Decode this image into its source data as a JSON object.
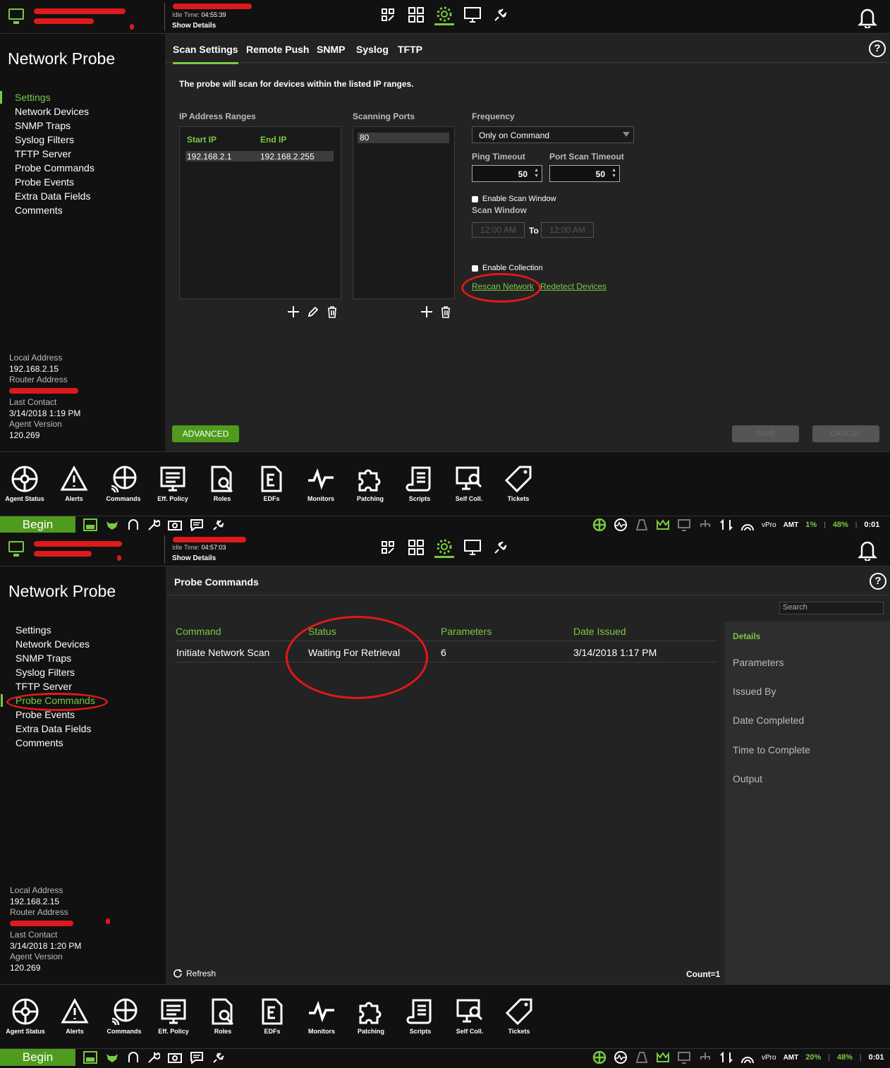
{
  "screens": [
    {
      "idle_label": "Idle Time:",
      "idle_time": "04:55:39",
      "show_details": "Show Details",
      "sidebar": {
        "title": "Network Probe",
        "items": [
          "Settings",
          "Network Devices",
          "SNMP Traps",
          "Syslog Filters",
          "TFTP Server",
          "Probe Commands",
          "Probe Events",
          "Extra Data Fields",
          "Comments"
        ],
        "active": "Settings",
        "local_address_label": "Local Address",
        "local_address": "192.168.2.15",
        "router_address_label": "Router Address",
        "last_contact_label": "Last Contact",
        "last_contact": "3/14/2018 1:19 PM",
        "agent_version_label": "Agent Version",
        "agent_version": "120.269"
      },
      "tabs": [
        "Scan Settings",
        "Remote Push",
        "SNMP",
        "Syslog",
        "TFTP"
      ],
      "active_tab": "Scan Settings",
      "intro": "The probe will scan for devices within the listed IP ranges.",
      "ip_ranges_label": "IP Address Ranges",
      "start_ip_label": "Start IP",
      "end_ip_label": "End IP",
      "ip_range": {
        "start": "192.168.2.1",
        "end": "192.168.2.255"
      },
      "scanning_ports_label": "Scanning Ports",
      "port": "80",
      "frequency_label": "Frequency",
      "frequency": "Only on Command",
      "ping_timeout_label": "Ping Timeout",
      "ping_timeout": "50",
      "port_scan_timeout_label": "Port Scan Timeout",
      "port_scan_timeout": "50",
      "enable_scan_window": "Enable Scan Window",
      "scan_window_label": "Scan Window",
      "scan_window_from": "12:00 AM",
      "scan_window_to_label": "To",
      "scan_window_to": "12:00 AM",
      "enable_collection": "Enable Collection",
      "rescan_network": "Rescan Network",
      "redetect_devices": "Redetect Devices",
      "advanced": "ADVANCED",
      "save": "SAVE",
      "cancel": "CANCEL",
      "cpu_pct": "1%",
      "mem_pct": "48%",
      "clock": "0:01"
    },
    {
      "idle_label": "Idle Time:",
      "idle_time": "04:57:03",
      "show_details": "Show Details",
      "sidebar": {
        "title": "Network Probe",
        "items": [
          "Settings",
          "Network Devices",
          "SNMP Traps",
          "Syslog Filters",
          "TFTP Server",
          "Probe Commands",
          "Probe Events",
          "Extra Data Fields",
          "Comments"
        ],
        "active": "Probe Commands",
        "local_address_label": "Local Address",
        "local_address": "192.168.2.15",
        "router_address_label": "Router Address",
        "last_contact_label": "Last Contact",
        "last_contact": "3/14/2018 1:20 PM",
        "agent_version_label": "Agent Version",
        "agent_version": "120.269"
      },
      "page_title": "Probe Commands",
      "search_placeholder": "Search",
      "columns": [
        "Command",
        "Status",
        "Parameters",
        "Date Issued"
      ],
      "rows": [
        {
          "command": "Initiate Network Scan",
          "status": "Waiting For Retrieval",
          "parameters": "6",
          "date_issued": "3/14/2018 1:17 PM"
        }
      ],
      "details_title": "Details",
      "details_items": [
        "Parameters",
        "Issued By",
        "Date Completed",
        "Time to Complete",
        "Output"
      ],
      "refresh": "Refresh",
      "count": "Count=1",
      "cpu_pct": "20%",
      "mem_pct": "48%",
      "clock": "0:01"
    }
  ],
  "bottom_nav": [
    "Agent Status",
    "Alerts",
    "Commands",
    "Eff. Policy",
    "Roles",
    "EDFs",
    "Monitors",
    "Patching",
    "Scripts",
    "Self Coll.",
    "Tickets"
  ],
  "taskbar": {
    "begin": "Begin",
    "vpro": "vPro",
    "amt": "AMT"
  },
  "colors": {
    "accent": "#7ac943",
    "annotation": "#e0191a",
    "background": "#232323",
    "sidebar": "#111111"
  }
}
